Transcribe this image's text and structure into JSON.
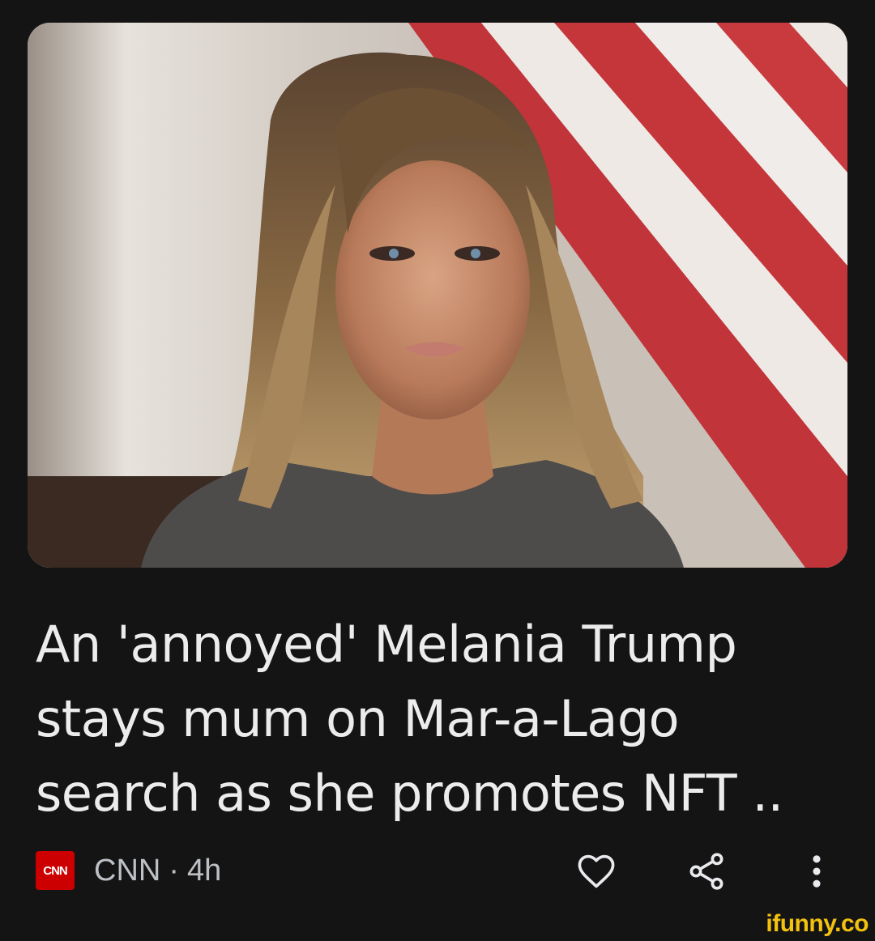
{
  "article": {
    "headline_lines": [
      "An 'annoyed' Melania Trump",
      "stays mum on Mar-a-Lago",
      "search as she promotes NFT .."
    ],
    "source_logo_text": "CNN",
    "source_name": "CNN",
    "separator": "·",
    "age": "4h",
    "image": {
      "alt_icon": "news-photo"
    }
  },
  "actions": {
    "like_icon": "heart-outline-icon",
    "share_icon": "share-icon",
    "more_icon": "more-vert-icon"
  },
  "watermark": {
    "text": "ifunny.co"
  },
  "colors": {
    "background": "#141414",
    "headline": "#ececec",
    "meta_text": "#bdc1c6",
    "cnn_red": "#cc0000",
    "watermark": "#f2c20f"
  }
}
